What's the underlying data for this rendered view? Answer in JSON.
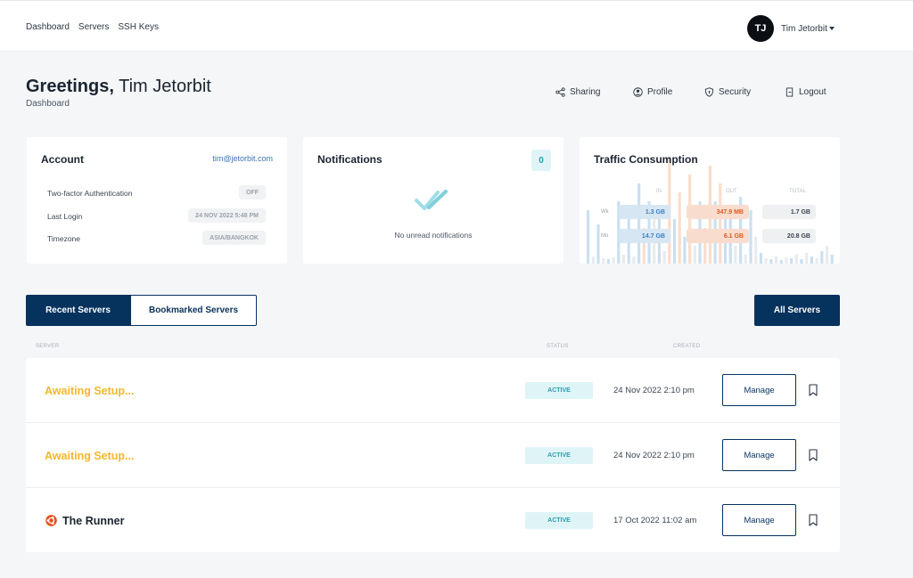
{
  "nav": {
    "items": [
      "Dashboard",
      "Servers",
      "SSH Keys"
    ]
  },
  "user": {
    "initials": "TJ",
    "name": "Tim Jetorbit"
  },
  "header": {
    "greeting": "Greetings,",
    "name": "Tim Jetorbit",
    "subtitle": "Dashboard"
  },
  "actions": {
    "sharing": "Sharing",
    "profile": "Profile",
    "security": "Security",
    "logout": "Logout"
  },
  "account": {
    "title": "Account",
    "email": "tim@jetorbit.com",
    "rows": [
      {
        "label": "Two-factor Authentication",
        "value": "OFF"
      },
      {
        "label": "Last Login",
        "value": "24 NOV 2022 5:48 PM"
      },
      {
        "label": "Timezone",
        "value": "ASIA/BANGKOK"
      }
    ]
  },
  "notifications": {
    "title": "Notifications",
    "count": "0",
    "empty_text": "No unread notifications"
  },
  "traffic": {
    "title": "Traffic Consumption",
    "headers": {
      "in": "IN",
      "out": "OUT",
      "total": "TOTAL"
    },
    "rows": [
      {
        "label": "Wk",
        "in": "1.3 GB",
        "out": "347.9 MB",
        "total": "1.7 GB"
      },
      {
        "label": "Mo",
        "in": "14.7 GB",
        "out": "6.1 GB",
        "total": "20.8 GB"
      }
    ],
    "colors": {
      "in": "#9fc8e6",
      "out": "#f6c3a4",
      "total": "#d7dbe0"
    }
  },
  "tabs": {
    "recent": "Recent Servers",
    "bookmarked": "Bookmarked Servers",
    "all": "All Servers"
  },
  "table": {
    "headers": {
      "server": "SERVER",
      "status": "STATUS",
      "created": "CREATED"
    },
    "rows": [
      {
        "name": "Awaiting Setup...",
        "status": "ACTIVE",
        "created": "24 Nov 2022 2:10 pm",
        "manage": "Manage"
      },
      {
        "name": "Awaiting Setup...",
        "status": "ACTIVE",
        "created": "24 Nov 2022 2:10 pm",
        "manage": "Manage"
      },
      {
        "name": "The Runner",
        "status": "ACTIVE",
        "created": "17 Oct 2022 11:02 am",
        "manage": "Manage"
      }
    ]
  },
  "colors": {
    "primary": "#06325e",
    "awaiting": "#f6b72a",
    "status_bg": "#dff4f6",
    "status_text": "#2a9eb0",
    "link": "#3b73b9",
    "ubuntu": "#e95420"
  },
  "icons": {
    "sharing": "share-icon",
    "profile": "user-circle-icon",
    "security": "shield-icon",
    "logout": "logout-icon",
    "notifications_empty": "double-check-icon",
    "bookmark": "bookmark-icon",
    "os": "ubuntu-icon"
  }
}
